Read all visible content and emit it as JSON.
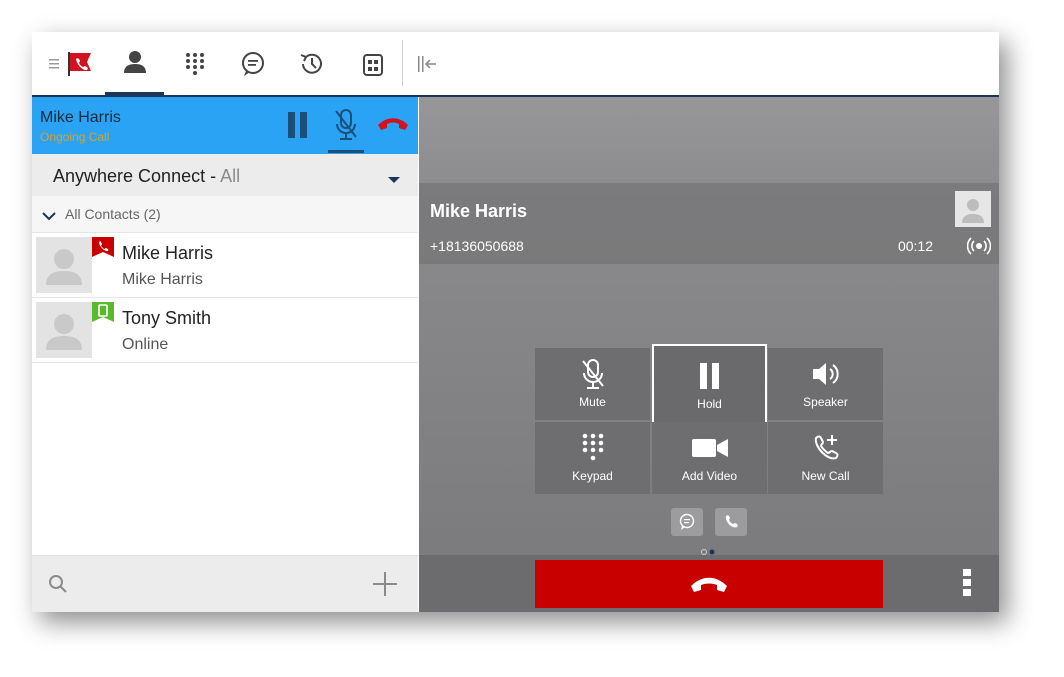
{
  "toolbar": {
    "items": [
      {
        "name": "menu",
        "icon": "hamburger-icon"
      },
      {
        "name": "presence",
        "icon": "red-phone-flag-icon"
      },
      {
        "name": "contacts",
        "icon": "person-icon",
        "active": true
      },
      {
        "name": "dialpad",
        "icon": "dialpad-icon"
      },
      {
        "name": "chat",
        "icon": "chat-bubble-icon"
      },
      {
        "name": "history",
        "icon": "history-clock-icon"
      },
      {
        "name": "directory",
        "icon": "building-icon"
      },
      {
        "name": "collapse",
        "icon": "collapse-panel-icon"
      }
    ]
  },
  "active_call_bar": {
    "name": "Mike Harris",
    "status": "Ongoing Call"
  },
  "filter": {
    "label": "Anywhere Connect -",
    "value": "All"
  },
  "group": {
    "label": "All Contacts (2)"
  },
  "contacts": [
    {
      "name": "Mike Harris",
      "sub": "Mike Harris",
      "presence": "on-call",
      "presence_color": "#c90000"
    },
    {
      "name": "Tony Smith",
      "sub": "Online",
      "presence": "online",
      "presence_color": "#5cb82e"
    }
  ],
  "call_info": {
    "name": "Mike Harris",
    "number": "+18136050688",
    "duration": "00:12"
  },
  "call_buttons": [
    {
      "label": "Mute",
      "icon": "mic-off-icon"
    },
    {
      "label": "Hold",
      "icon": "pause-icon",
      "selected": true
    },
    {
      "label": "Speaker",
      "icon": "speaker-icon"
    },
    {
      "label": "Keypad",
      "icon": "keypad-icon"
    },
    {
      "label": "Add Video",
      "icon": "video-camera-icon"
    },
    {
      "label": "New Call",
      "icon": "phone-plus-icon"
    }
  ],
  "colors": {
    "accent_blue": "#2aa3f4",
    "navy": "#1d3557",
    "end_call_red": "#c90000",
    "online_green": "#5cb82e"
  }
}
